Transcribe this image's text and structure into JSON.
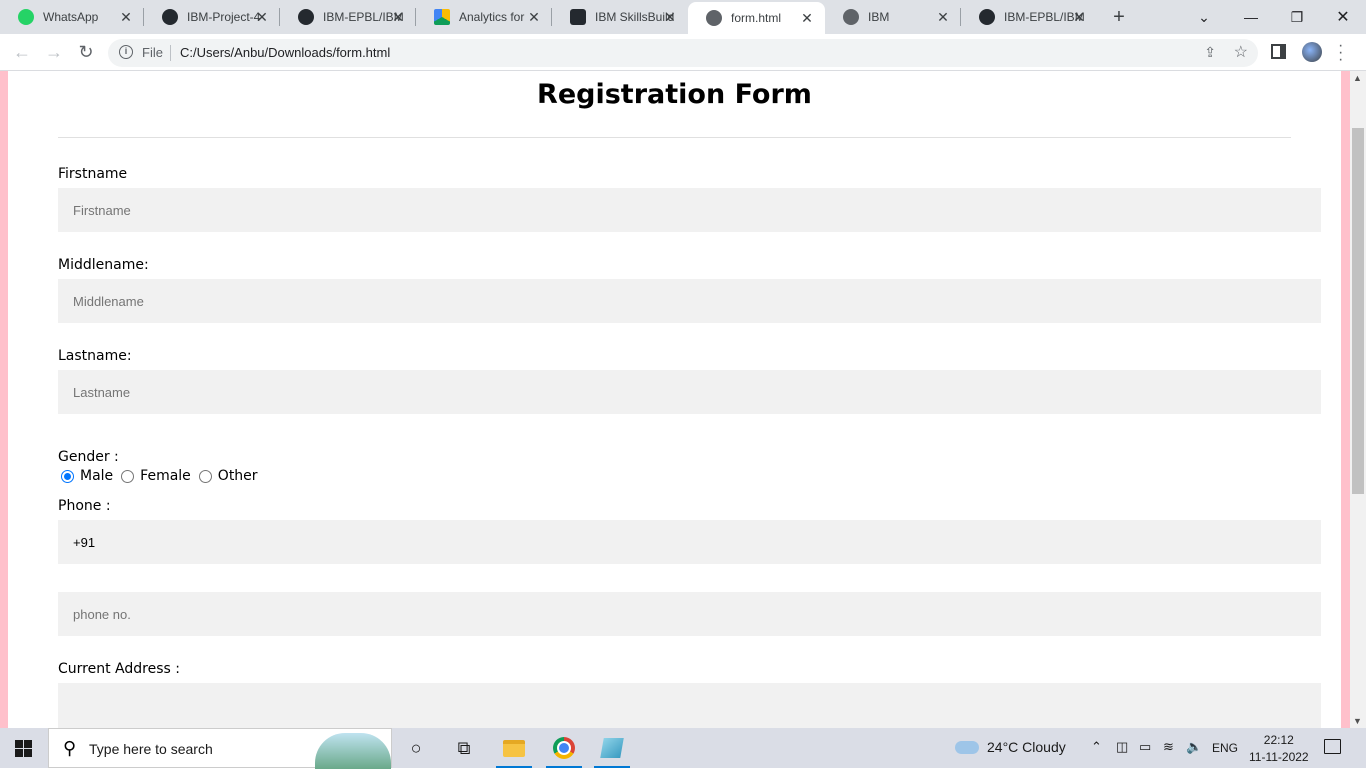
{
  "browser": {
    "tabs": [
      {
        "label": "WhatsApp",
        "favicon": "whatsapp-icon",
        "color": "#25d366"
      },
      {
        "label": "IBM-Project-4",
        "favicon": "github-icon",
        "color": "#24292f"
      },
      {
        "label": "IBM-EPBL/IBM",
        "favicon": "github-icon",
        "color": "#24292f"
      },
      {
        "label": "Analytics for",
        "favicon": "drive-icon",
        "color": "#fbbc04"
      },
      {
        "label": "IBM SkillsBuild",
        "favicon": "skillsbuild-icon",
        "color": "#24292f"
      },
      {
        "label": "form.html",
        "favicon": "globe-icon",
        "color": "#5f6368",
        "active": true
      },
      {
        "label": "IBM",
        "favicon": "globe-icon",
        "color": "#5f6368"
      },
      {
        "label": "IBM-EPBL/IBM",
        "favicon": "github-icon",
        "color": "#24292f"
      }
    ],
    "close_glyph": "✕",
    "new_tab_glyph": "+",
    "omnibox": {
      "scheme_label": "File",
      "url": "C:/Users/Anbu/Downloads/form.html"
    }
  },
  "form": {
    "heading": "Registration Form",
    "firstname": {
      "label": "Firstname",
      "placeholder": "Firstname"
    },
    "middlename": {
      "label": "Middlename:",
      "placeholder": "Middlename"
    },
    "lastname": {
      "label": "Lastname:",
      "placeholder": "Lastname"
    },
    "gender": {
      "label": "Gender :",
      "options": [
        "Male",
        "Female",
        "Other"
      ],
      "selected": "Male"
    },
    "phone": {
      "label": "Phone :",
      "code_value": "+91",
      "number_placeholder": "phone no."
    },
    "address": {
      "label": "Current Address :"
    }
  },
  "taskbar": {
    "search_placeholder": "Type here to search",
    "weather": "24°C  Cloudy",
    "language": "ENG",
    "time": "22:12",
    "date": "11-11-2022"
  },
  "colors": {
    "page_background": "#ffc0cb",
    "field_background": "#f1f1f1",
    "radio_accent": "#0075ff"
  }
}
